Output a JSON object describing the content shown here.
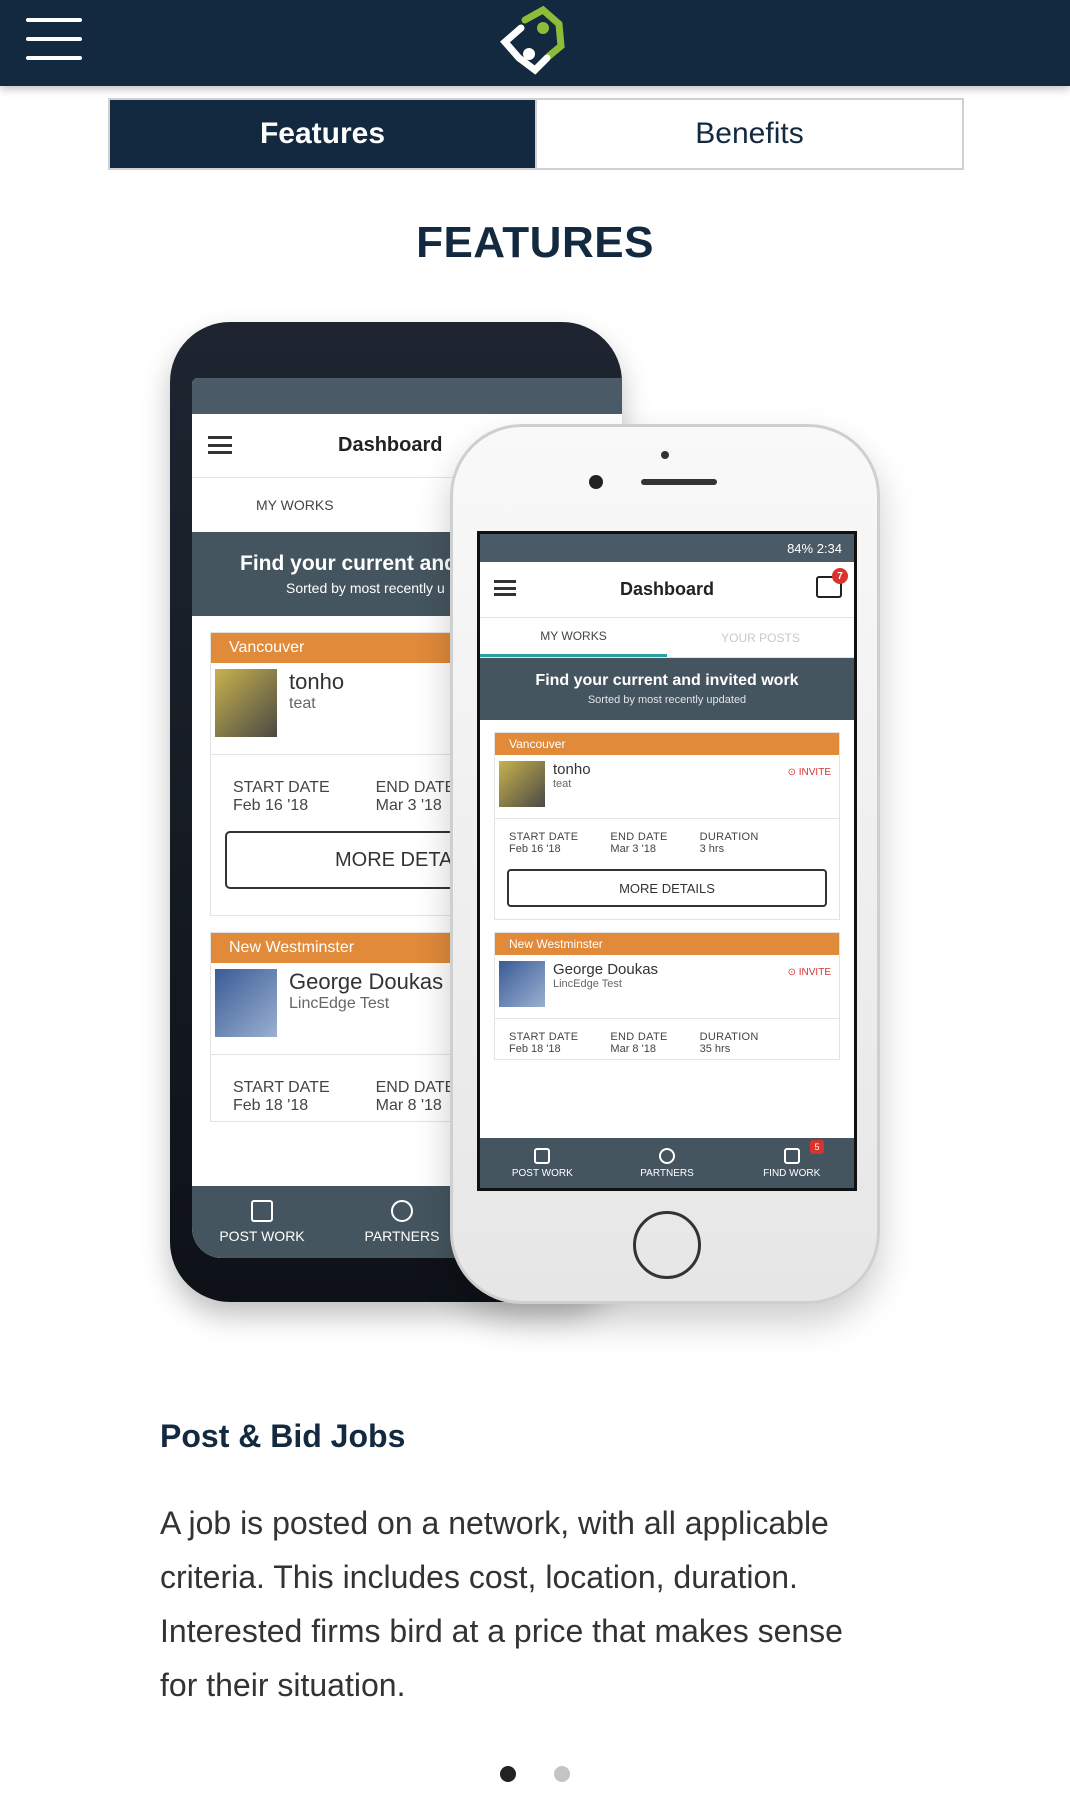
{
  "header": {
    "menu_icon": "hamburger-menu-icon",
    "logo_icon": "lincedge-logo-icon",
    "colors": {
      "navy": "#12293f",
      "green": "#8bbd3a"
    }
  },
  "tabs": [
    {
      "label": "Features",
      "active": true
    },
    {
      "label": "Benefits",
      "active": false
    }
  ],
  "section_title": "FEATURES",
  "phone_mockup": {
    "app_title": "Dashboard",
    "status_text": "84%  2:34",
    "subtabs": [
      "MY WORKS",
      "YOUR POSTS"
    ],
    "banner_title": "Find your current and invited work",
    "banner_subtitle": "Sorted by most recently updated",
    "android_banner_title": "Find your current and in",
    "android_banner_subtitle": "Sorted by most recently u",
    "inbox_badge": "7",
    "cards": [
      {
        "location": "Vancouver",
        "name": "tonho",
        "company": "teat",
        "invite": "INVITE",
        "start_label": "START DATE",
        "start": "Feb 16 '18",
        "end_label": "END DATE",
        "end": "Mar 3 '18",
        "duration_label": "DURATION",
        "duration": "3 hrs",
        "more": "MORE DETAILS",
        "android_more": "MORE DETAIL"
      },
      {
        "location": "New Westminster",
        "name": "George Doukas",
        "company": "LincEdge Test",
        "invite": "INVITE",
        "start_label": "START DATE",
        "start": "Feb 18 '18",
        "end_label": "END DATE",
        "end": "Mar 8 '18",
        "duration_label": "DURATION",
        "duration": "35 hrs"
      }
    ],
    "bottom_nav": [
      {
        "label": "POST WORK",
        "icon": "plus-square-icon"
      },
      {
        "label": "PARTNERS",
        "icon": "star-icon"
      },
      {
        "label": "FIND WORK",
        "icon": "handshake-icon",
        "badge": "5"
      }
    ]
  },
  "feature": {
    "title": "Post & Bid Jobs",
    "description": "A job is posted on a network, with all applicable criteria. This includes cost, location, duration. Interested firms bird at a price that makes sense for their situation."
  },
  "carousel": {
    "pages": 2,
    "current": 1
  }
}
